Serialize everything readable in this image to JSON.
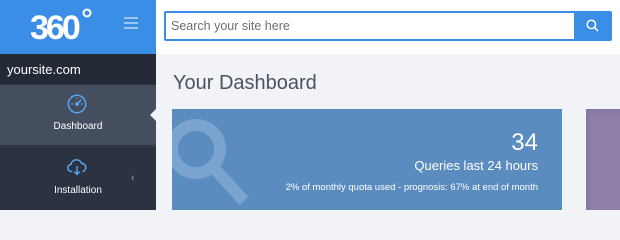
{
  "brand": {
    "logo_text": "360°",
    "accent": "#3a8ee6"
  },
  "sidebar": {
    "site_name": "yoursite.com",
    "items": [
      {
        "label": "Dashboard",
        "icon": "speedometer-icon",
        "active": true
      },
      {
        "label": "Installation",
        "icon": "cloud-download-icon",
        "active": false
      }
    ]
  },
  "search": {
    "placeholder": "Search your site here",
    "value": ""
  },
  "main": {
    "title": "Your Dashboard",
    "stat_card": {
      "value": "34",
      "label": "Queries last 24 hours",
      "note": "2% of monthly quota used - prognosis: 67% at end of month",
      "icon": "search-icon",
      "color": "#5b8cbf"
    },
    "side_card_color": "#8a7aa3"
  }
}
